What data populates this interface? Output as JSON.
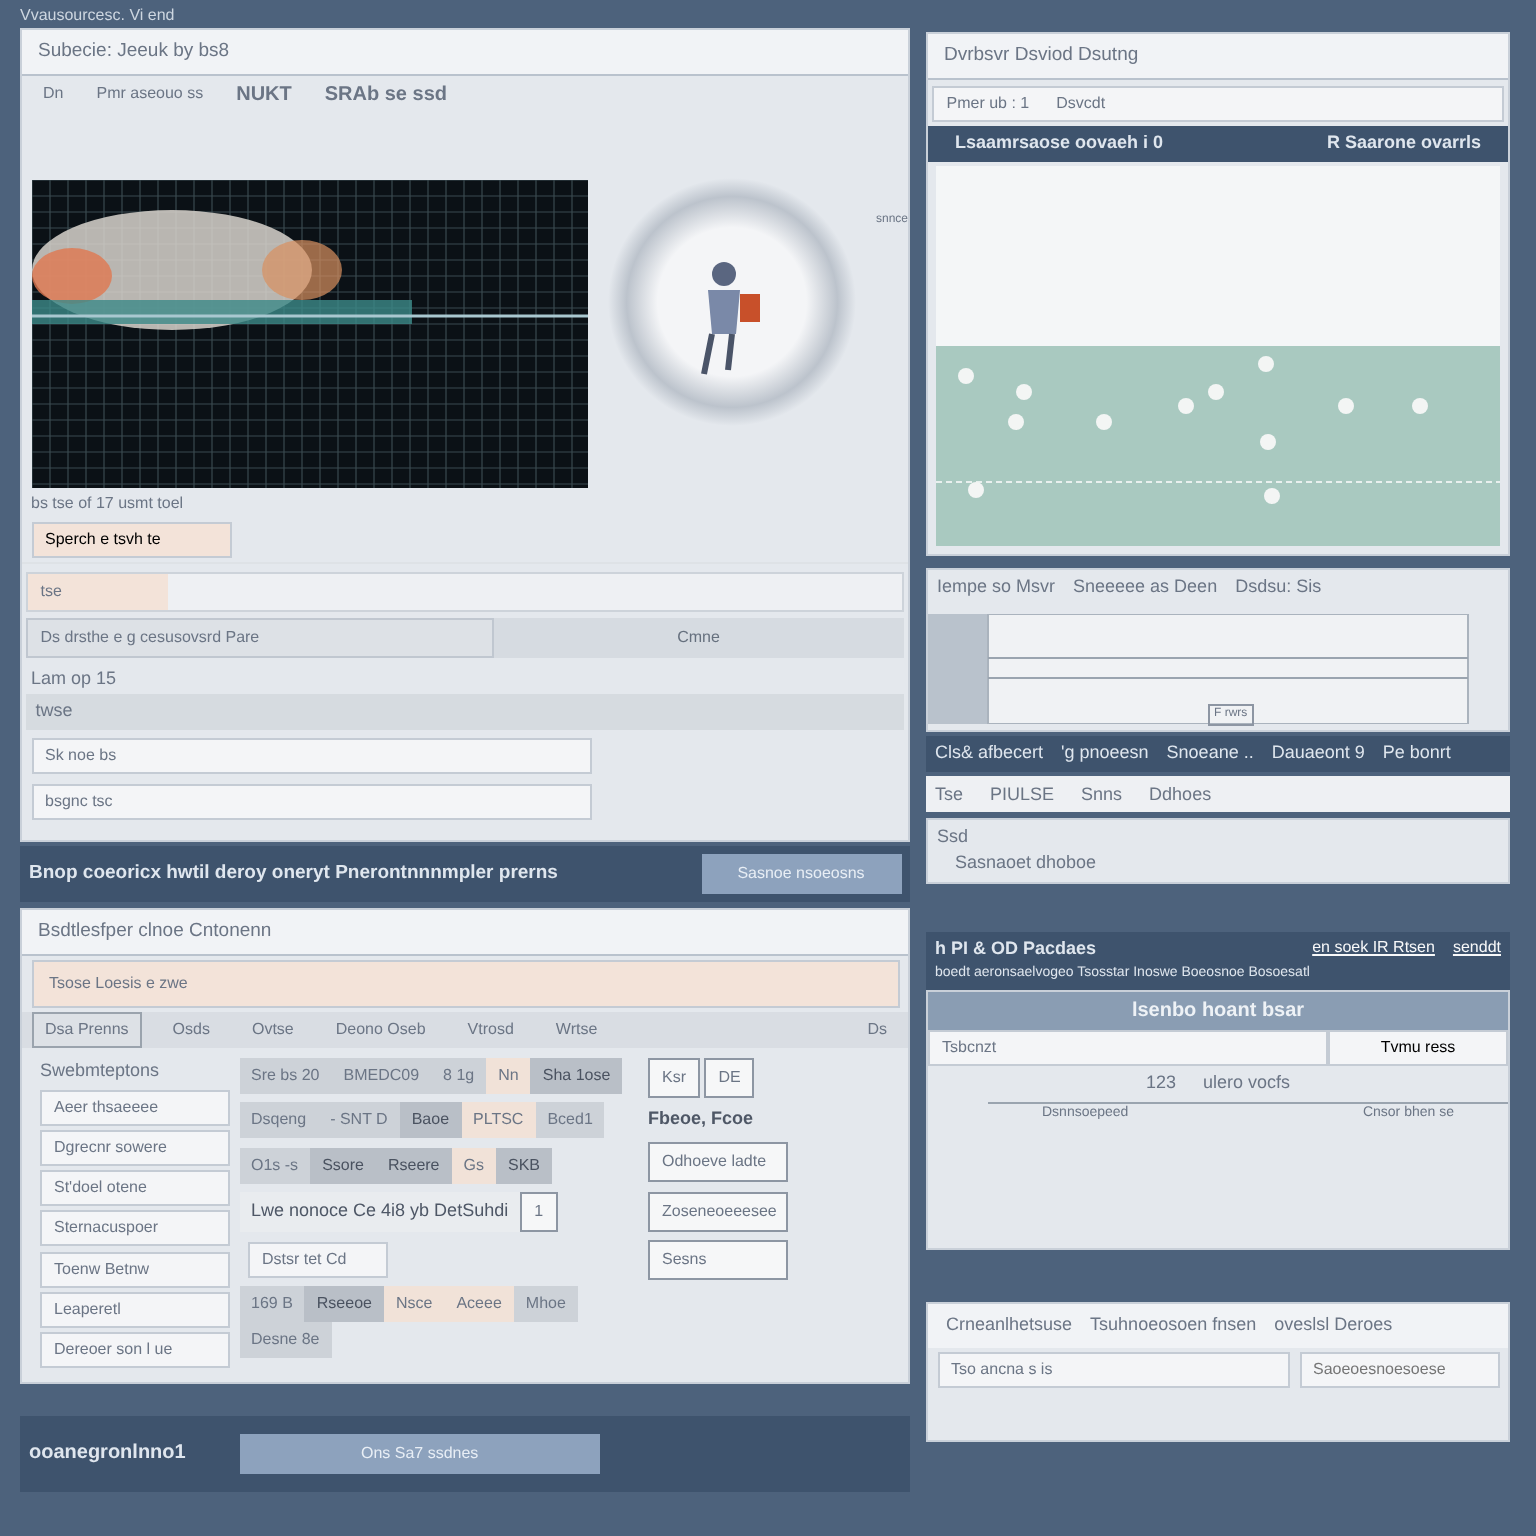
{
  "top_bar": {
    "title": "Vvausourcesc. Vi end"
  },
  "main_panel": {
    "title": "Subecie: Jeeuk by bs8",
    "toolbar": [
      "Dn",
      "Pmr aseouo ss",
      "NUKT",
      "SRAb se ssd"
    ],
    "side_label": "snnce",
    "caption": "bs tse of 17 usmt toel",
    "search": {
      "value": "Sperch e tsvh te"
    },
    "tag": "tse",
    "info_text": "Ds drsthe e g cesusovsrd Pare",
    "info_button": "Cmne",
    "group_label": "Lam op 15",
    "group_field": "twse",
    "notes": [
      "Sk noe bs",
      "bsgnc tsc"
    ]
  },
  "action_bar": {
    "text": "Bnop coeoricx hwtil deroy oneryt Pnerontnnnmpler prerns",
    "button": "Sasnoe nsoeosns"
  },
  "form_panel": {
    "title": "Bsdtlesfper clnoe Cntonenn",
    "banner": "Tsose Loesis e zwe",
    "tabs": [
      {
        "label": "Dsa Prenns",
        "selected": true
      },
      {
        "label": "Osds",
        "selected": false
      },
      {
        "label": "Ovtse",
        "selected": false
      },
      {
        "label": "Deono Oseb",
        "selected": false
      },
      {
        "label": "Vtrosd",
        "selected": false
      },
      {
        "label": "Wrtse",
        "selected": false
      }
    ],
    "dropdown": "Ds",
    "heading": "Swebmteptons",
    "fields": [
      "Aeer thsaeeee",
      "Dgrecnr sowere",
      "St'doel otene",
      "Sternacuspoer",
      "Toenw Betnw",
      "Leaperetl",
      "Dereoer son l ue"
    ],
    "chip_rows": [
      [
        {
          "text": "Sre bs 20",
          "kind": "gray"
        },
        {
          "text": "BMEDC09",
          "kind": "gray"
        },
        {
          "text": "8 1g",
          "kind": "gray"
        },
        {
          "text": "Nn",
          "kind": "peach"
        },
        {
          "text": "Sha 1ose",
          "kind": "dark"
        }
      ],
      [
        {
          "text": "Dsqeng",
          "kind": "gray"
        },
        {
          "text": "- SNT D",
          "kind": "gray"
        },
        {
          "text": "Baoe",
          "kind": "dark"
        },
        {
          "text": "PLTSC",
          "kind": "peach"
        },
        {
          "text": "Bced1",
          "kind": "gray"
        }
      ],
      [
        {
          "text": "O1s -s",
          "kind": "gray"
        },
        {
          "text": "Ssore",
          "kind": "dark"
        },
        {
          "text": "Rseere",
          "kind": "dark"
        },
        {
          "text": "Gs",
          "kind": "peach"
        },
        {
          "text": "SKB",
          "kind": "dark"
        }
      ],
      [
        {
          "text": "Lwe nonoce Ce 4i8 yb DetSuhdi",
          "kind": "plain"
        },
        {
          "text": "1",
          "kind": "outline"
        }
      ],
      [
        {
          "text": "169 B",
          "kind": "gray"
        },
        {
          "text": "Rseeoe",
          "kind": "dark"
        },
        {
          "text": "Nsce",
          "kind": "peach"
        },
        {
          "text": "Aceee",
          "kind": "peach"
        },
        {
          "text": "Mhoe",
          "kind": "gray"
        },
        {
          "text": "Desne 8e",
          "kind": "gray"
        }
      ]
    ],
    "small_field": "Dstsr tet Cd",
    "side_buttons": [
      "Ksr",
      "DE"
    ],
    "side_label": "Fbeoe, Fcoe",
    "side_actions": [
      "Odhoeve ladte",
      "Zoseneoeeesee",
      "Sesns"
    ]
  },
  "footer": {
    "text": "ooanegronlnno1",
    "button": "Ons Sa7 ssdnes"
  },
  "device_panel": {
    "title": "Dvrbsvr Dsviod Dsutng",
    "field_label": "Pmer ub : 1",
    "field_value": "Dsvcdt",
    "bar_left": "Lsaamrsaose oovaeh i 0",
    "bar_right": "R Saarone ovarrls"
  },
  "trend_panel": {
    "labels": [
      "Iempe so Msvr",
      "Sneeeee as Deen",
      "Dsdsu: Sis"
    ],
    "marker": "F rwrs"
  },
  "status_bar": {
    "items": [
      "Cls& afbecert",
      "'g pnoeesn",
      "Snoeane ..",
      "Dauaeont 9",
      "Pe bonrt"
    ]
  },
  "detail_row": [
    "Tse",
    "PIULSE",
    "Snns",
    "Ddhoes"
  ],
  "note_panel": {
    "title": "Ssd",
    "text": "Sasnaoet dhoboe"
  },
  "package_bar": {
    "title": "h PI & OD Pacdaes",
    "links": [
      "en soek IR Rtsen",
      "senddt"
    ],
    "ticker": "boedt aeronsaelvogeo Tsosstar Inoswe Boeosnoe Bosoesatl"
  },
  "load_panel": {
    "title": "lsenbo hoant bsar",
    "field": "Tsbcnzt",
    "button": "Tvmu ress",
    "range": [
      "123",
      "ulero vocfs"
    ],
    "labels": [
      "Dsnnsoepeed",
      "Cnsor bhen se"
    ]
  },
  "bottom_panel": {
    "tabs": [
      "Crneanlhetsuse",
      "Tsuhnoeosoen fnsen",
      "oveslsl Deroes"
    ],
    "field_label": "Tso ancna s is",
    "search_placeholder": "Saoeoesnoesoese"
  }
}
